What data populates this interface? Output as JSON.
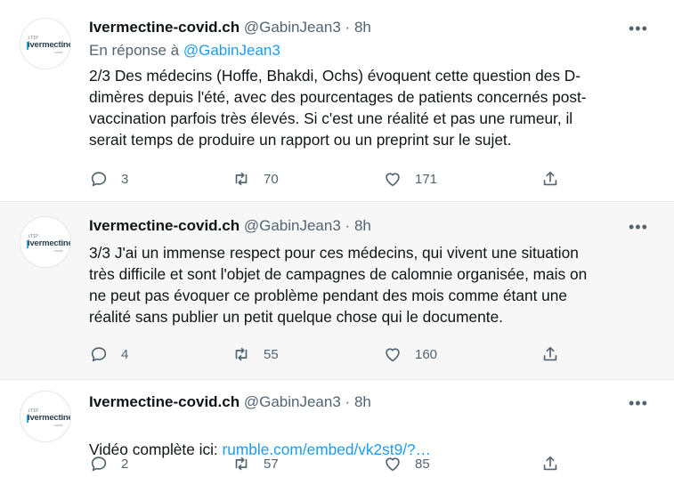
{
  "tweets": [
    {
      "author": {
        "name": "Ivermectine-covid.ch",
        "handle": "@GabinJean3",
        "time": "8h"
      },
      "reply_prefix": "En réponse à",
      "reply_handle": "@GabinJean3",
      "text": "2/3 Des médecins (Hoffe, Bhakdi, Ochs) évoquent cette question des D-\ndimères depuis l'été, avec des pourcentages de patients concernés post-\nvaccination parfois très élevés. Si c'est une réalité et pas une rumeur, il\nserait temps de produire un rapport ou un preprint sur le sujet.",
      "replies": "3",
      "retweets": "70",
      "likes": "171"
    },
    {
      "author": {
        "name": "Ivermectine-covid.ch",
        "handle": "@GabinJean3",
        "time": "8h"
      },
      "text": "3/3 J'ai un immense respect pour ces médecins, qui vivent une situation\ntrès difficile et sont l'objet de campagnes de calomnie organisée, mais on\nne peut pas évoquer ce problème pendant des mois comme étant une\nréalité sans publier un petit quelque chose qui le documente.",
      "replies": "4",
      "retweets": "55",
      "likes": "160"
    },
    {
      "author": {
        "name": "Ivermectine-covid.ch",
        "handle": "@GabinJean3",
        "time": "8h"
      },
      "text_prefix": "Vidéo complète ici: ",
      "link": "rumble.com/embed/vk2st9/?…",
      "replies": "2",
      "retweets": "57",
      "likes": "85"
    }
  ],
  "avatar_logo": {
    "top": "iTIP",
    "main": "ivermectine",
    "sub": "covid"
  },
  "separator": "·",
  "more_glyph": "•••",
  "colors": {
    "link": "#1d9bf0",
    "secondary": "#536471",
    "highlight_bg": "#f7f7f7"
  },
  "icons": [
    "reply-icon",
    "retweet-icon",
    "like-icon",
    "share-icon",
    "more-icon"
  ]
}
